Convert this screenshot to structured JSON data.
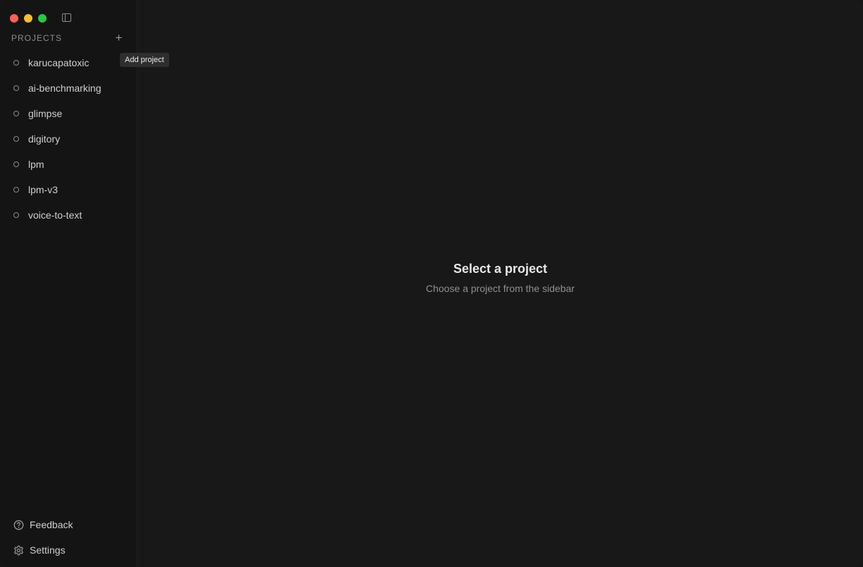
{
  "sidebar": {
    "section_title": "PROJECTS",
    "add_button_icon": "plus-icon",
    "add_button_symbol": "+",
    "tooltip": "Add project",
    "projects": [
      {
        "label": "karucapatoxic"
      },
      {
        "label": "ai-benchmarking"
      },
      {
        "label": "glimpse"
      },
      {
        "label": "digitory"
      },
      {
        "label": "lpm"
      },
      {
        "label": "lpm-v3"
      },
      {
        "label": "voice-to-text"
      }
    ],
    "feedback_label": "Feedback",
    "settings_label": "Settings"
  },
  "main": {
    "empty_title": "Select a project",
    "empty_subtitle": "Choose a project from the sidebar"
  },
  "colors": {
    "background": "#181818",
    "sidebar_background": "#141414",
    "close": "#fe5f57",
    "minimize": "#febc2e",
    "maximize": "#28c840"
  }
}
